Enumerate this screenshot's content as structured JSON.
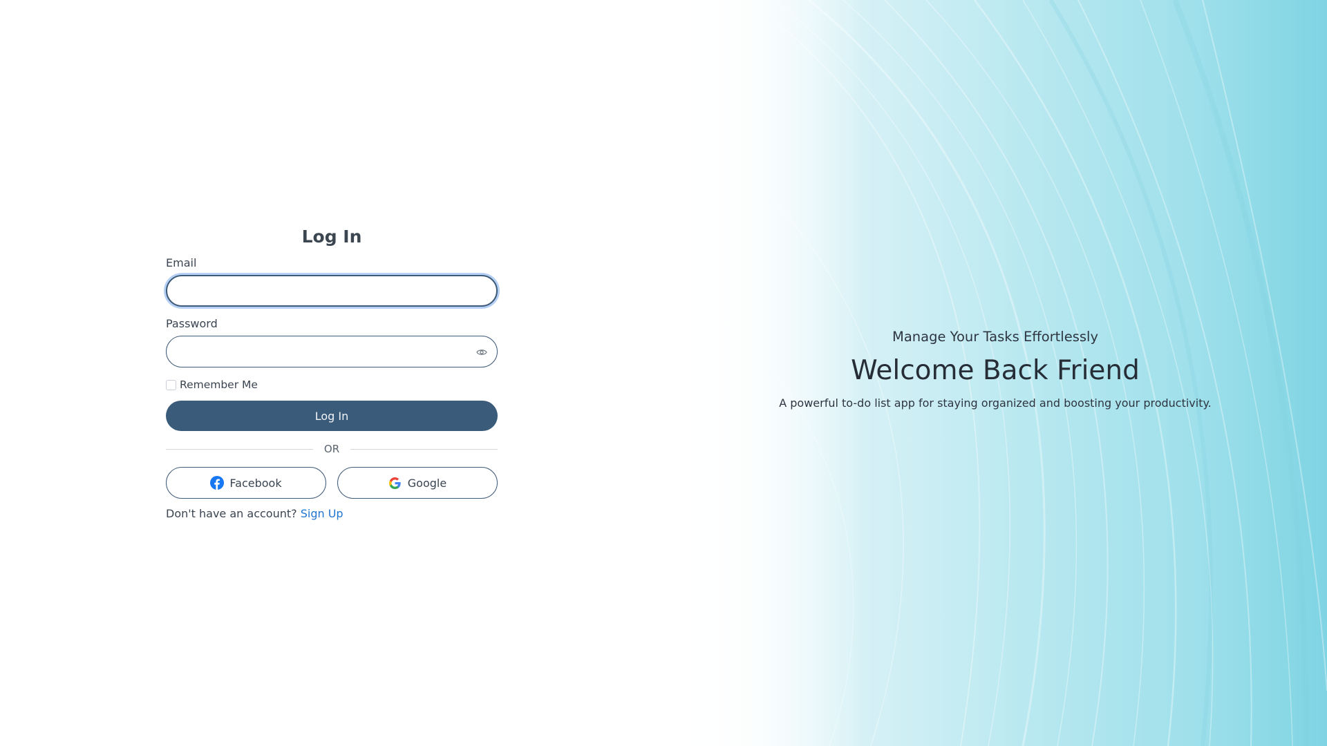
{
  "login": {
    "title": "Log In",
    "email_label": "Email",
    "email_value": "",
    "password_label": "Password",
    "password_value": "",
    "remember_label": "Remember Me",
    "remember_checked": false,
    "submit_label": "Log In",
    "divider_label": "OR",
    "facebook_label": "Facebook",
    "google_label": "Google",
    "signup_prompt": "Don't have an account?",
    "signup_link": "Sign Up"
  },
  "hero": {
    "subtitle": "Manage Your Tasks Effortlessly",
    "title": "Welcome Back Friend",
    "description": "A powerful to-do list app for staying organized and boosting your productivity."
  },
  "icons": {
    "password_toggle": "eye-icon",
    "facebook": "facebook-icon",
    "google": "google-icon"
  },
  "colors": {
    "primary": "#3b5b7b",
    "link": "#1f74d1",
    "facebook": "#1877f2",
    "hero_accent": "#9fe0eb"
  }
}
